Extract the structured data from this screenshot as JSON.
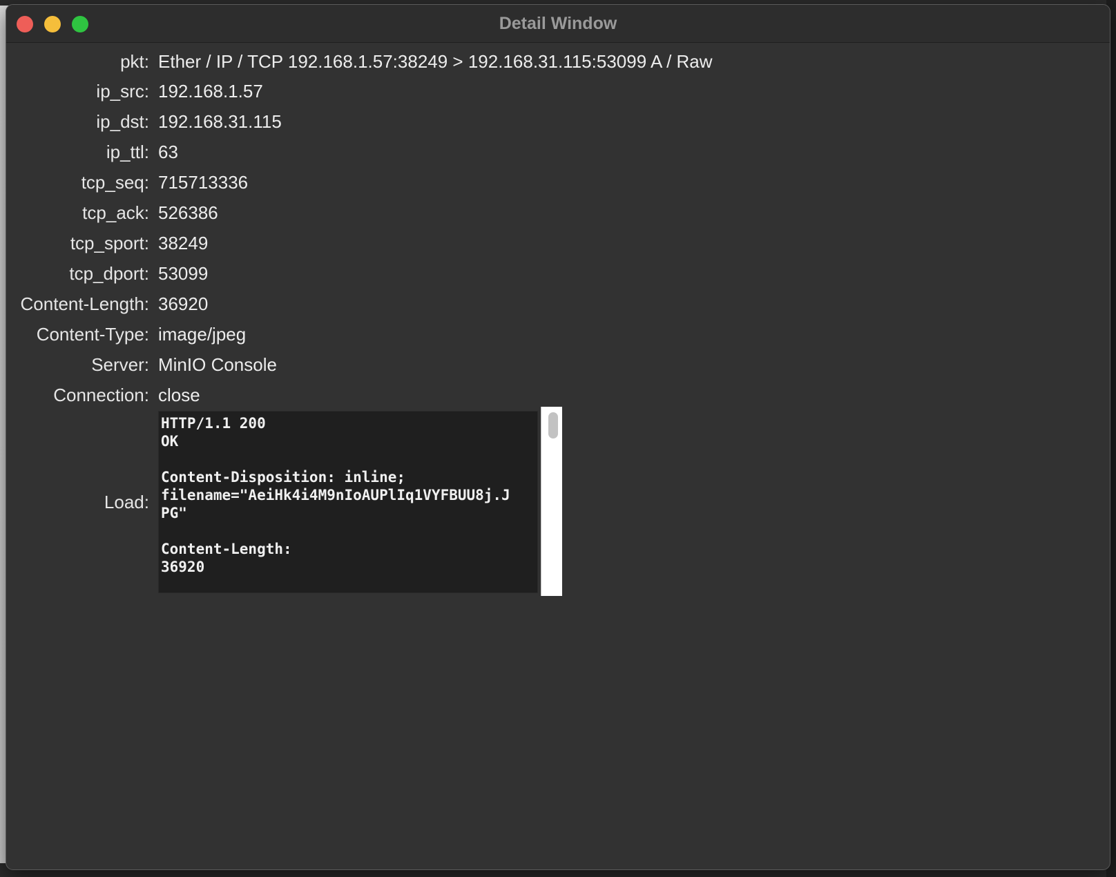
{
  "window": {
    "title": "Detail Window"
  },
  "fields": [
    {
      "label": "pkt:",
      "value": "Ether / IP / TCP 192.168.1.57:38249 > 192.168.31.115:53099 A / Raw"
    },
    {
      "label": "ip_src:",
      "value": "192.168.1.57"
    },
    {
      "label": "ip_dst:",
      "value": "192.168.31.115"
    },
    {
      "label": "ip_ttl:",
      "value": "63"
    },
    {
      "label": "tcp_seq:",
      "value": "715713336"
    },
    {
      "label": "tcp_ack:",
      "value": "526386"
    },
    {
      "label": "tcp_sport:",
      "value": "38249"
    },
    {
      "label": "tcp_dport:",
      "value": "53099"
    },
    {
      "label": "Content-Length:",
      "value": "36920"
    },
    {
      "label": "Content-Type:",
      "value": "image/jpeg"
    },
    {
      "label": "Server:",
      "value": "MinIO Console"
    },
    {
      "label": "Connection:",
      "value": "close"
    }
  ],
  "load": {
    "label": "Load:",
    "text": "HTTP/1.1 200\nOK\n\nContent-Disposition: inline;\nfilename=\"AeiHk4i4M9nIoAUPlIq1VYFBUU8j.J\nPG\"\n\nContent-Length:\n36920"
  },
  "colors": {
    "window_bg": "#323232",
    "close": "#ee5e58",
    "minimize": "#f5be3b",
    "maximize": "#2fc441"
  }
}
